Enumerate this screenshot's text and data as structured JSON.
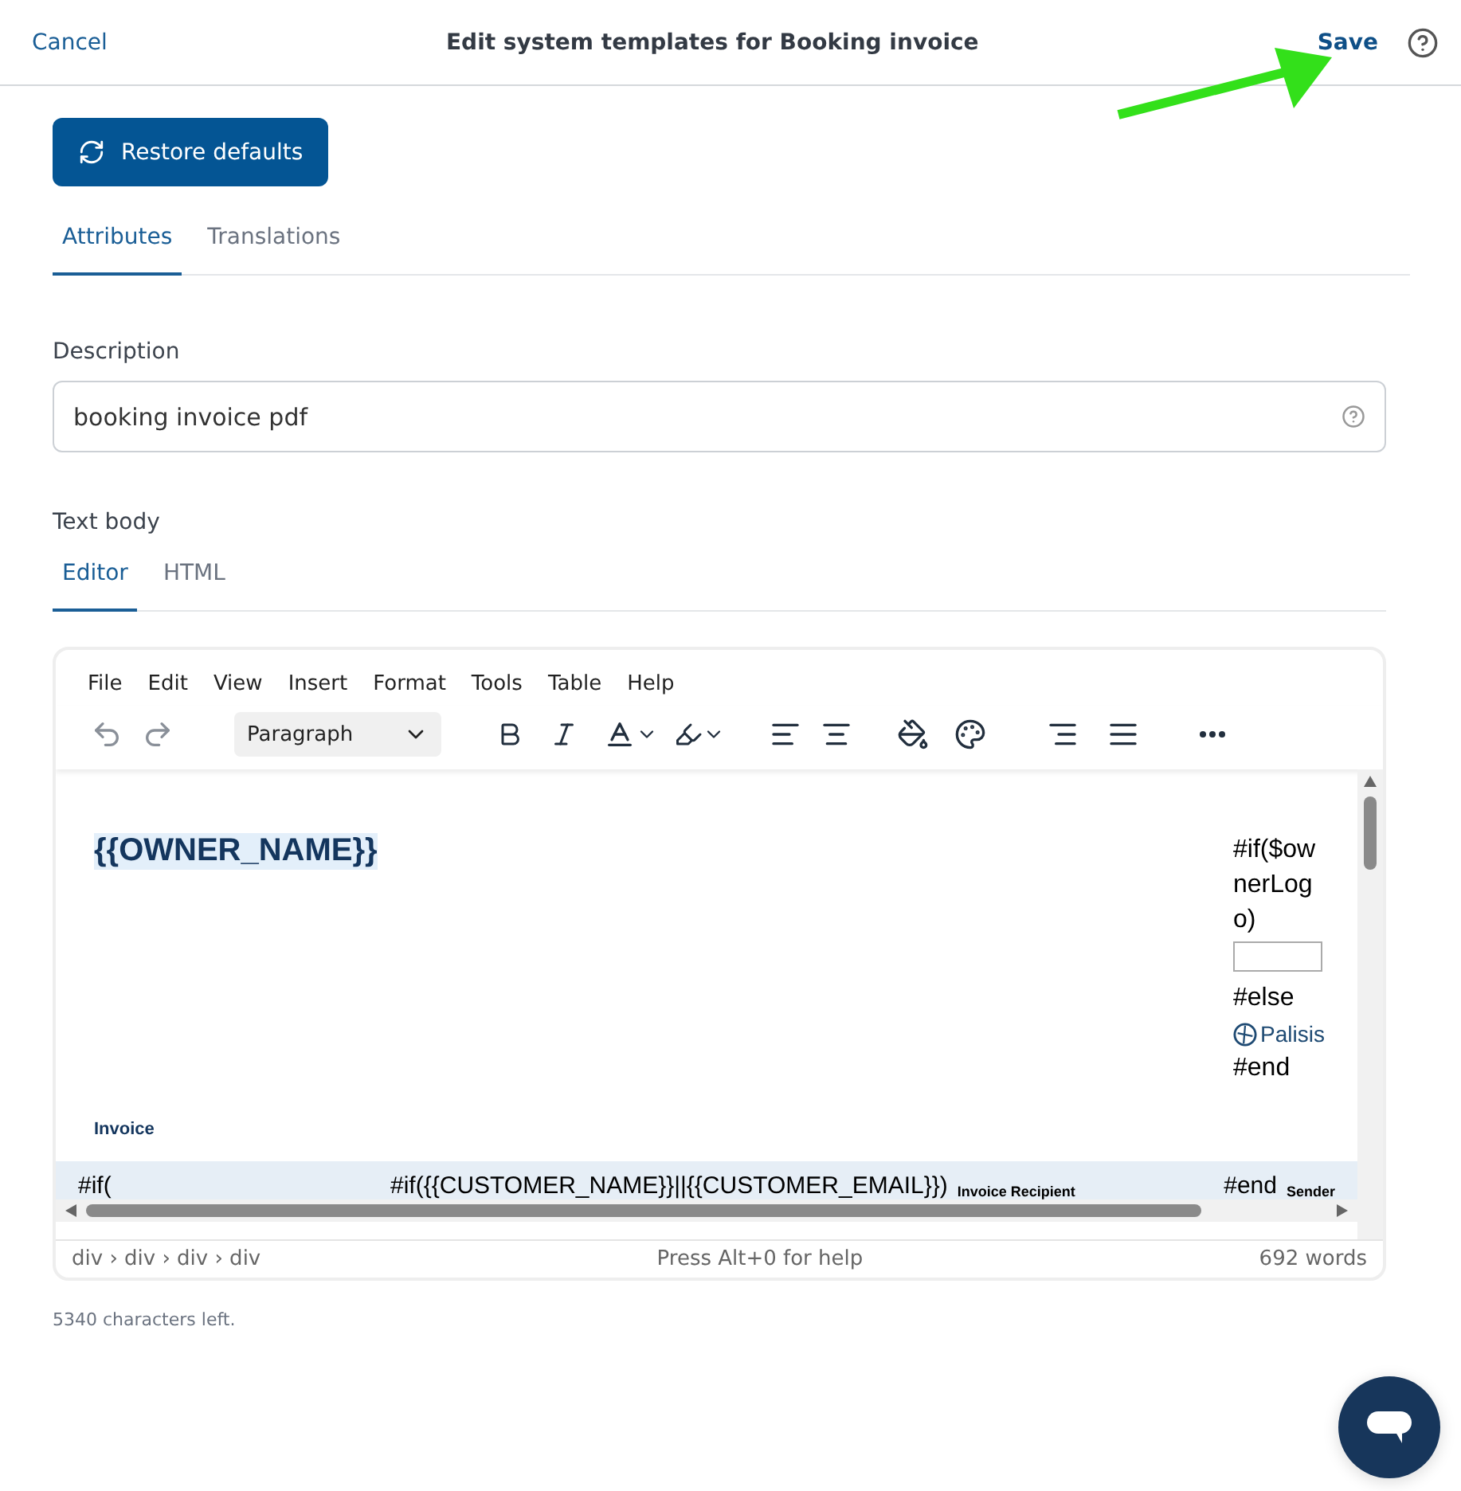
{
  "header": {
    "cancel": "Cancel",
    "title": "Edit system templates for Booking invoice",
    "save": "Save"
  },
  "restore_button": "Restore defaults",
  "tabs": [
    {
      "label": "Attributes",
      "selected": true
    },
    {
      "label": "Translations",
      "selected": false
    }
  ],
  "description": {
    "label": "Description",
    "value": "booking invoice pdf"
  },
  "text_body": {
    "label": "Text body",
    "tabs": [
      {
        "label": "Editor",
        "selected": true
      },
      {
        "label": "HTML",
        "selected": false
      }
    ]
  },
  "editor": {
    "menu": [
      "File",
      "Edit",
      "View",
      "Insert",
      "Format",
      "Tools",
      "Table",
      "Help"
    ],
    "block_format": "Paragraph",
    "content": {
      "owner_name": "{{OWNER_NAME}}",
      "logo_lines": [
        "#if($ow",
        "nerLog",
        "o)"
      ],
      "else": "#else",
      "brand": "Palisis",
      "end": "#end",
      "invoice": "Invoice",
      "row": [
        "#if(",
        "#if({{CUSTOMER_NAME}}||{{CUSTOMER_EMAIL}})",
        "Invoice Recipient",
        "#end",
        "Sender"
      ]
    },
    "path": "div › div › div › div",
    "help": "Press Alt+0 for help",
    "words": "692 words"
  },
  "chars_left": "5340 characters left."
}
